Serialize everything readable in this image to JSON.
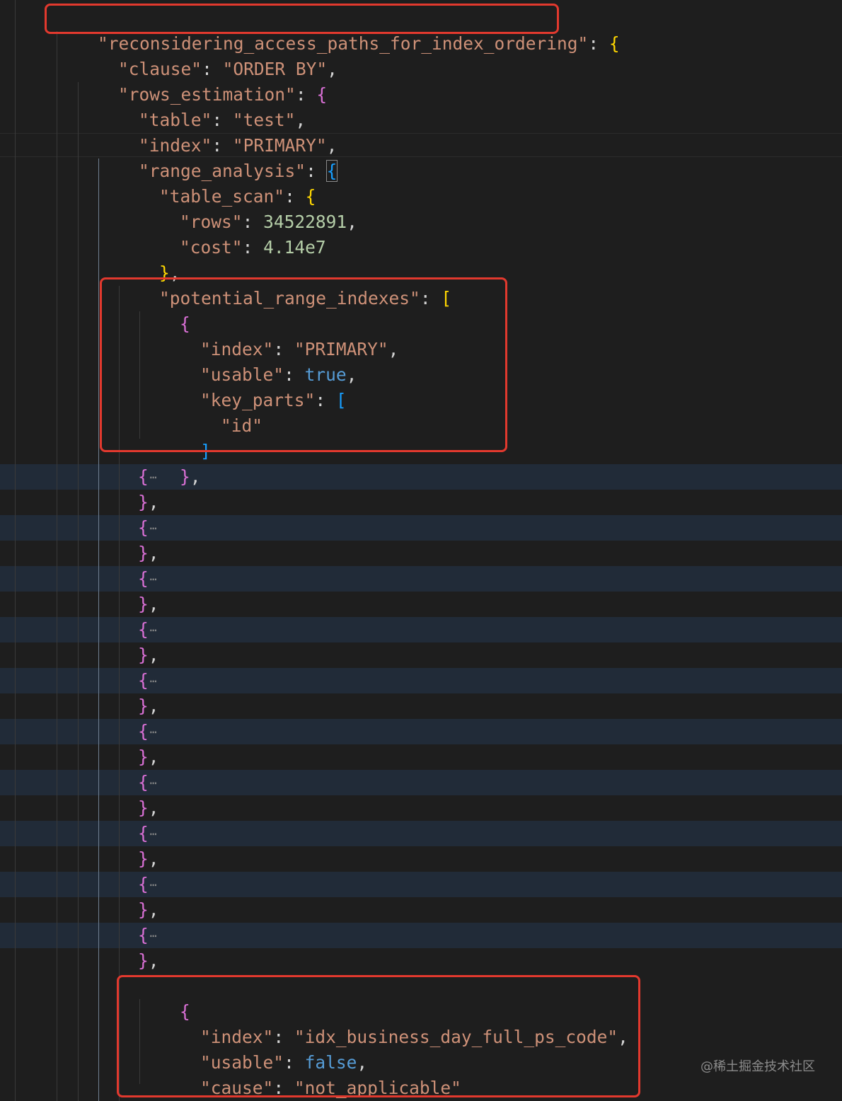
{
  "watermark": "@稀土掘金技术社区",
  "ellipsis": "⋯",
  "code": {
    "root_key": "reconsidering_access_paths_for_index_ordering",
    "clause_key": "clause",
    "clause_value": "ORDER BY",
    "rows_estimation_key": "rows_estimation",
    "table_key": "table",
    "table_value": "test",
    "index_key": "index",
    "index_value": "PRIMARY",
    "range_analysis_key": "range_analysis",
    "table_scan_key": "table_scan",
    "rows_key": "rows",
    "rows_value": "34522891",
    "cost_key": "cost",
    "cost_value": "4.14e7",
    "potential_range_indexes_key": "potential_range_indexes",
    "first_index": {
      "index_key": "index",
      "index_value": "PRIMARY",
      "usable_key": "usable",
      "usable_value": "true",
      "key_parts_key": "key_parts",
      "key_part": "id"
    },
    "last_index": {
      "index_key": "index",
      "index_value": "idx_business_day_full_ps_code",
      "usable_key": "usable",
      "usable_value": "false",
      "cause_key": "cause",
      "cause_value": "not_applicable"
    }
  }
}
